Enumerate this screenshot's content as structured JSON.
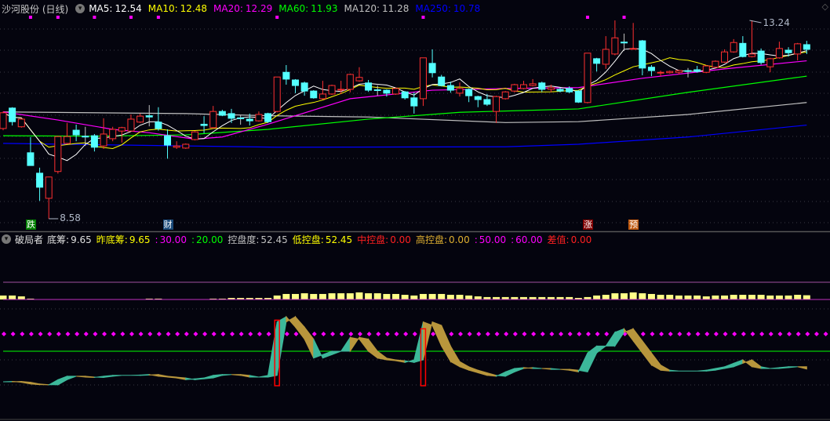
{
  "header": {
    "title": "沙河股份 (日线)",
    "toggle_icon": "chevron-down-circle-icon",
    "ma": [
      {
        "label": "MA5:",
        "value": "12.54",
        "color": "#ffffff"
      },
      {
        "label": "MA10:",
        "value": "12.48",
        "color": "#ffff00"
      },
      {
        "label": "MA20:",
        "value": "12.29",
        "color": "#ff00ff"
      },
      {
        "label": "MA60:",
        "value": "11.93",
        "color": "#00ff00"
      },
      {
        "label": "MA120:",
        "value": "11.28",
        "color": "#c0c0c0"
      },
      {
        "label": "MA250:",
        "value": "10.78",
        "color": "#0000ff"
      }
    ]
  },
  "indicator": {
    "name": "破局者",
    "items": [
      {
        "label": "底筹:",
        "value": "9.65",
        "color": "#e0e0e0"
      },
      {
        "label": "昨底筹:",
        "value": "9.65",
        "color": "#ffff00"
      },
      {
        "label": ":",
        "value": "30.00",
        "color": "#ff00ff"
      },
      {
        "label": ":",
        "value": "20.00",
        "color": "#00ff00"
      },
      {
        "label": "控盘度:",
        "value": "52.45",
        "color": "#c0c0c0"
      },
      {
        "label": "低控盘:",
        "value": "52.45",
        "color": "#ffff00"
      },
      {
        "label": "中控盘:",
        "value": "0.00",
        "color": "#ff2020"
      },
      {
        "label": "高控盘:",
        "value": "0.00",
        "color": "#e0b030"
      },
      {
        "label": ":",
        "value": "50.00",
        "color": "#ff00ff"
      },
      {
        "label": ":",
        "value": "60.00",
        "color": "#ff00ff"
      },
      {
        "label": "差值:",
        "value": "0.00",
        "color": "#ff2020"
      }
    ]
  },
  "price_labels": {
    "high": "13.24",
    "high_index": 82,
    "low": "8.58",
    "low_index": 5
  },
  "markers": [
    {
      "text": "跌",
      "index": 3,
      "color": "#008000"
    },
    {
      "text": "财",
      "index": 18,
      "color": "#1a4a7a"
    },
    {
      "text": "涨",
      "index": 64,
      "color": "#800000"
    },
    {
      "text": "预",
      "index": 69,
      "color": "#c05a10"
    }
  ],
  "chart_data": [
    {
      "type": "candlestick",
      "title": "沙河股份 (日线)",
      "up_color": "#ff3030",
      "down_color": "#54ffff",
      "ohlc": [
        [
          10.7,
          11.1,
          10.66,
          11.07
        ],
        [
          11.18,
          11.2,
          10.77,
          10.86
        ],
        [
          10.74,
          10.94,
          10.72,
          10.92
        ],
        [
          10.13,
          10.5,
          9.83,
          9.83
        ],
        [
          9.65,
          9.78,
          9.0,
          9.32
        ],
        [
          9.06,
          9.57,
          8.58,
          9.56
        ],
        [
          9.69,
          10.53,
          9.64,
          10.51
        ],
        [
          10.35,
          10.83,
          10.33,
          10.51
        ],
        [
          10.66,
          10.79,
          10.4,
          10.55
        ],
        [
          10.52,
          10.74,
          10.29,
          10.5
        ],
        [
          10.53,
          10.57,
          10.16,
          10.26
        ],
        [
          10.29,
          10.94,
          10.22,
          10.57
        ],
        [
          10.46,
          10.74,
          10.4,
          10.68
        ],
        [
          10.64,
          10.74,
          10.37,
          10.72
        ],
        [
          10.64,
          11.03,
          10.64,
          10.92
        ],
        [
          10.85,
          11.05,
          10.83,
          10.99
        ],
        [
          11.0,
          11.25,
          10.75,
          10.97
        ],
        [
          10.85,
          11.2,
          10.65,
          10.7
        ],
        [
          10.53,
          10.68,
          9.99,
          10.31
        ],
        [
          10.26,
          10.4,
          10.22,
          10.29
        ],
        [
          10.24,
          10.35,
          10.22,
          10.33
        ],
        [
          10.44,
          10.64,
          10.42,
          10.62
        ],
        [
          10.8,
          10.99,
          10.59,
          10.77
        ],
        [
          10.72,
          11.23,
          10.7,
          11.1
        ],
        [
          11.1,
          11.14,
          10.99,
          11.01
        ],
        [
          11.05,
          11.16,
          10.83,
          10.94
        ],
        [
          10.95,
          11.01,
          10.79,
          10.93
        ],
        [
          10.92,
          11.05,
          10.77,
          10.88
        ],
        [
          10.88,
          11.1,
          10.86,
          11.03
        ],
        [
          11.05,
          11.07,
          10.83,
          10.86
        ],
        [
          11.1,
          11.91,
          11.08,
          11.91
        ],
        [
          12.02,
          12.19,
          11.73,
          11.86
        ],
        [
          11.84,
          11.86,
          11.53,
          11.71
        ],
        [
          11.77,
          11.8,
          11.47,
          11.58
        ],
        [
          11.58,
          11.6,
          11.4,
          11.42
        ],
        [
          11.4,
          11.82,
          11.38,
          11.51
        ],
        [
          11.51,
          11.73,
          11.49,
          11.71
        ],
        [
          11.62,
          11.82,
          11.51,
          11.62
        ],
        [
          11.62,
          11.99,
          11.55,
          11.97
        ],
        [
          11.82,
          12.14,
          11.8,
          11.9
        ],
        [
          11.77,
          11.84,
          11.56,
          11.6
        ],
        [
          11.61,
          11.71,
          11.47,
          11.6
        ],
        [
          11.6,
          11.62,
          11.45,
          11.53
        ],
        [
          11.51,
          11.66,
          11.49,
          11.64
        ],
        [
          11.56,
          11.58,
          11.38,
          11.42
        ],
        [
          11.42,
          11.55,
          11.05,
          11.23
        ],
        [
          11.4,
          12.36,
          11.23,
          12.36
        ],
        [
          12.23,
          12.56,
          11.9,
          12.01
        ],
        [
          11.91,
          11.96,
          11.69,
          11.71
        ],
        [
          11.71,
          11.8,
          11.54,
          11.6
        ],
        [
          11.53,
          11.78,
          11.45,
          11.64
        ],
        [
          11.62,
          11.64,
          11.32,
          11.47
        ],
        [
          11.45,
          11.47,
          11.2,
          11.38
        ],
        [
          11.38,
          11.51,
          11.23,
          11.27
        ],
        [
          11.1,
          11.47,
          10.83,
          11.45
        ],
        [
          11.4,
          11.58,
          11.38,
          11.56
        ],
        [
          11.58,
          11.75,
          11.55,
          11.73
        ],
        [
          11.64,
          11.82,
          11.62,
          11.73
        ],
        [
          11.71,
          11.86,
          11.69,
          11.75
        ],
        [
          11.77,
          11.8,
          11.56,
          11.62
        ],
        [
          11.62,
          11.73,
          11.55,
          11.66
        ],
        [
          11.62,
          11.66,
          11.55,
          11.58
        ],
        [
          11.64,
          11.69,
          11.53,
          11.56
        ],
        [
          11.58,
          11.6,
          11.3,
          11.32
        ],
        [
          11.31,
          12.47,
          11.29,
          12.47
        ],
        [
          12.34,
          12.36,
          12.04,
          12.23
        ],
        [
          12.21,
          12.87,
          12.1,
          12.56
        ],
        [
          12.45,
          13.24,
          12.42,
          12.83
        ],
        [
          12.73,
          12.93,
          12.52,
          12.71
        ],
        [
          12.58,
          13.18,
          12.56,
          12.58
        ],
        [
          12.76,
          12.78,
          11.95,
          12.12
        ],
        [
          12.14,
          12.19,
          11.93,
          12.06
        ],
        [
          12.02,
          12.06,
          11.93,
          12.02
        ],
        [
          12.01,
          12.06,
          11.99,
          12.04
        ],
        [
          12.02,
          12.08,
          11.97,
          12.06
        ],
        [
          12.06,
          12.12,
          11.9,
          12.04
        ],
        [
          12.08,
          12.17,
          12.01,
          12.04
        ],
        [
          12.02,
          12.19,
          12.0,
          12.17
        ],
        [
          12.14,
          12.3,
          12.12,
          12.28
        ],
        [
          12.26,
          12.56,
          12.24,
          12.5
        ],
        [
          12.5,
          12.8,
          12.48,
          12.72
        ],
        [
          12.7,
          12.87,
          12.37,
          12.39
        ],
        [
          12.39,
          13.24,
          12.37,
          12.45
        ],
        [
          12.52,
          12.58,
          12.2,
          12.25
        ],
        [
          12.15,
          12.36,
          12.02,
          12.34
        ],
        [
          12.36,
          12.74,
          12.34,
          12.58
        ],
        [
          12.54,
          12.61,
          12.39,
          12.48
        ],
        [
          12.45,
          12.71,
          12.3,
          12.69
        ],
        [
          12.67,
          12.76,
          12.45,
          12.56
        ]
      ],
      "ma_series": {
        "MA20": [
          [
            0,
            11.09
          ],
          [
            6,
            10.9
          ],
          [
            12,
            10.68
          ],
          [
            16,
            10.6
          ],
          [
            21,
            10.45
          ],
          [
            24,
            10.5
          ],
          [
            29,
            10.8
          ],
          [
            38,
            11.4
          ],
          [
            47,
            11.6
          ],
          [
            55,
            11.64
          ],
          [
            63,
            11.66
          ],
          [
            70,
            11.88
          ],
          [
            79,
            12.1
          ],
          [
            88,
            12.29
          ]
        ],
        "MA60": [
          [
            0,
            10.53
          ],
          [
            10,
            10.52
          ],
          [
            20,
            10.55
          ],
          [
            29,
            10.68
          ],
          [
            40,
            10.92
          ],
          [
            50,
            11.08
          ],
          [
            63,
            11.16
          ],
          [
            75,
            11.55
          ],
          [
            88,
            11.93
          ]
        ],
        "MA120": [
          [
            0,
            11.09
          ],
          [
            20,
            11.05
          ],
          [
            29,
            11.0
          ],
          [
            40,
            10.97
          ],
          [
            55,
            10.84
          ],
          [
            63,
            10.86
          ],
          [
            75,
            11.03
          ],
          [
            88,
            11.31
          ]
        ],
        "MA250": [
          [
            0,
            10.35
          ],
          [
            30,
            10.26
          ],
          [
            55,
            10.27
          ],
          [
            63,
            10.33
          ],
          [
            75,
            10.5
          ],
          [
            88,
            10.78
          ]
        ]
      },
      "signal_dots": [
        3,
        6,
        10,
        14,
        17,
        30,
        46,
        64,
        68
      ],
      "ylim": [
        8.58,
        13.24
      ]
    },
    {
      "type": "indicator",
      "title": "破局者",
      "ylim": [
        0,
        62
      ],
      "底筹": [
        2.3,
        2.5,
        2.0,
        1.0,
        0.6,
        0.5,
        3.5,
        5.5,
        5.5,
        5.0,
        4.8,
        5.5,
        6.0,
        6.0,
        6.0,
        6.2,
        6.5,
        5.5,
        5.0,
        4.5,
        3.5,
        4.0,
        4.5,
        6.0,
        6.5,
        6.5,
        6.0,
        5.0,
        5.0,
        6.0,
        37,
        40,
        34,
        27,
        16,
        18,
        20,
        20,
        28,
        27,
        20,
        16,
        15,
        14.5,
        13.5,
        15,
        37,
        35,
        23,
        14,
        11,
        9,
        7.5,
        6,
        5.5,
        8,
        10,
        10.5,
        10,
        10,
        9.5,
        9.5,
        9,
        8,
        19,
        23,
        23,
        31,
        33,
        26,
        19,
        12,
        9,
        8.5,
        8.5,
        8.5,
        8.5,
        9,
        10,
        11,
        13,
        15,
        11,
        10,
        10,
        10.5,
        11,
        11,
        9.65
      ],
      "控盘度": [
        52.3,
        52.3,
        51.8,
        50.5,
        0,
        0,
        0,
        0,
        0,
        0,
        0,
        0,
        0,
        0,
        0,
        0,
        50.5,
        50.5,
        0,
        0,
        0,
        0,
        0,
        50.5,
        50.5,
        50.9,
        50.9,
        50.9,
        50.9,
        50.9,
        52.3,
        53.2,
        53.2,
        53.6,
        53.2,
        53.2,
        53.6,
        53.6,
        53.6,
        54.1,
        53.6,
        53.6,
        53.2,
        53.2,
        52.7,
        52.3,
        53.2,
        53.2,
        53.2,
        52.7,
        52.7,
        52.3,
        51.8,
        51.4,
        51.4,
        51.4,
        51.4,
        51.4,
        51.4,
        51.4,
        51.4,
        51.4,
        51.4,
        50.9,
        51.4,
        52.3,
        52.7,
        53.6,
        53.6,
        54.1,
        53.6,
        53.2,
        52.7,
        52.7,
        52.3,
        52.3,
        52.3,
        51.8,
        52.3,
        52.3,
        52.7,
        52.7,
        52.7,
        52.7,
        52.3,
        52.3,
        52.3,
        52.7,
        52.45
      ],
      "signal_boxes": [
        {
          "index": 30,
          "value": 38
        },
        {
          "index": 46,
          "value": 33
        }
      ],
      "levels": {
        "low": 20,
        "mid": 30,
        "high1": 50,
        "high2": 60
      },
      "rise_color": "#3cb89a",
      "fall_color": "#b8963c",
      "bar_color": "#ffff88"
    }
  ]
}
